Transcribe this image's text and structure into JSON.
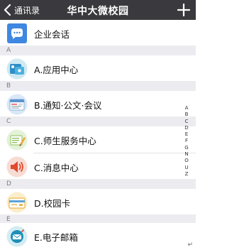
{
  "header": {
    "back_label": "通讯录",
    "title": "华中大微校园"
  },
  "company_chat": {
    "label": "企业会话"
  },
  "sections": [
    {
      "letter": "A",
      "label": "A.应用中心"
    },
    {
      "letter": "B",
      "label": "B.通知·公文·会议"
    },
    {
      "letter": "C",
      "label": "C.师生服务中心"
    },
    {
      "letter": "",
      "label": "C.消息中心"
    },
    {
      "letter": "D",
      "label": "D.校园卡"
    },
    {
      "letter": "E",
      "label": "E.电子邮箱"
    }
  ],
  "index_letters": [
    "A",
    "B",
    "C",
    "D",
    "E",
    "F",
    "G",
    "N",
    "O",
    "U",
    "Z"
  ],
  "corner_mark": "↵",
  "colors": {
    "header_bg": "#3a3a3e",
    "section_bg": "#ececf0",
    "chat_icon_bg": "#3f87e0"
  }
}
